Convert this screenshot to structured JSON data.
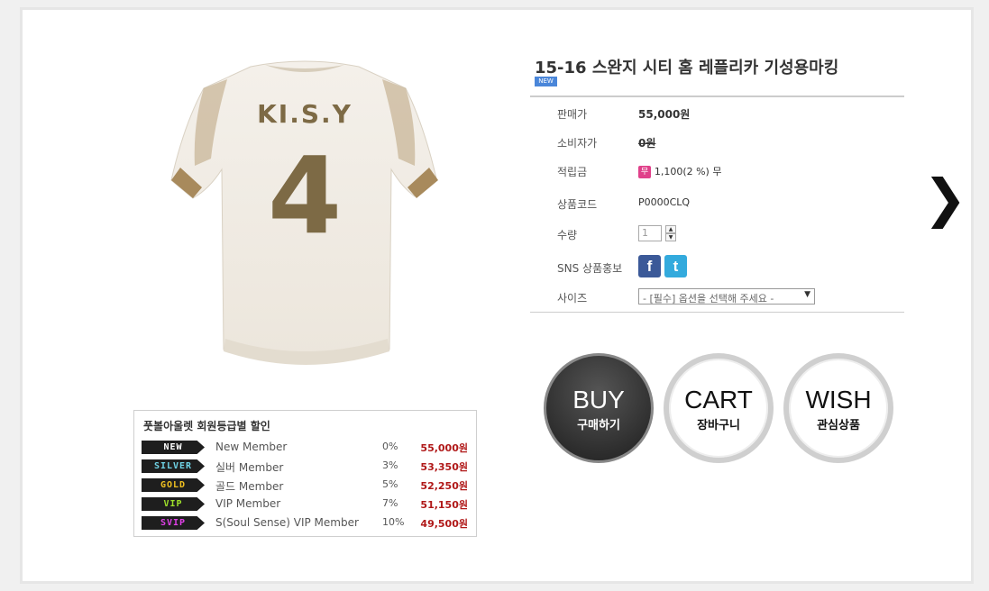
{
  "product": {
    "title": "15-16 스완지 시티 홈 레플리카 기성용마킹",
    "new_badge": "NEW",
    "jersey_name": "KI.S.Y",
    "jersey_number": "4"
  },
  "info": {
    "sale_price_label": "판매가",
    "sale_price": "55,000원",
    "consumer_price_label": "소비자가",
    "consumer_price": "0원",
    "points_label": "적립금",
    "points_icon": "무",
    "points_value": "1,100(2 %) 무",
    "code_label": "상품코드",
    "code_value": "P0000CLQ",
    "qty_label": "수량",
    "qty_value": "1",
    "sns_label": "SNS 상품홍보",
    "size_label": "사이즈",
    "size_placeholder": "- [필수] 옵션을 선택해 주세요 -"
  },
  "actions": {
    "buy": {
      "en": "BUY",
      "ko": "구매하기"
    },
    "cart": {
      "en": "CART",
      "ko": "장바구니"
    },
    "wish": {
      "en": "WISH",
      "ko": "관심상품"
    }
  },
  "discount": {
    "title": "풋볼아울렛 회원등급별 할인",
    "tiers": [
      {
        "badge": "NEW",
        "name": "New Member",
        "pct": "0%",
        "price": "55,000원",
        "color": "#ffffff"
      },
      {
        "badge": "SILVER",
        "name": "실버 Member",
        "pct": "3%",
        "price": "53,350원",
        "color": "#6fd3e6"
      },
      {
        "badge": "GOLD",
        "name": "골드 Member",
        "pct": "5%",
        "price": "52,250원",
        "color": "#f0c020"
      },
      {
        "badge": "VIP",
        "name": "VIP Member",
        "pct": "7%",
        "price": "51,150원",
        "color": "#9ee02a"
      },
      {
        "badge": "SVIP",
        "name": "S(Soul Sense) VIP Member",
        "pct": "10%",
        "price": "49,500원",
        "color": "#e040e8"
      }
    ]
  },
  "colors": {
    "price_red": "#b01818",
    "facebook": "#3b5998",
    "twitter": "#33aadd",
    "new_badge": "#4a86d9"
  },
  "icons": {
    "next": "chevron-right-icon",
    "facebook": "facebook-icon",
    "twitter": "twitter-icon",
    "points": "mu-badge-icon"
  }
}
